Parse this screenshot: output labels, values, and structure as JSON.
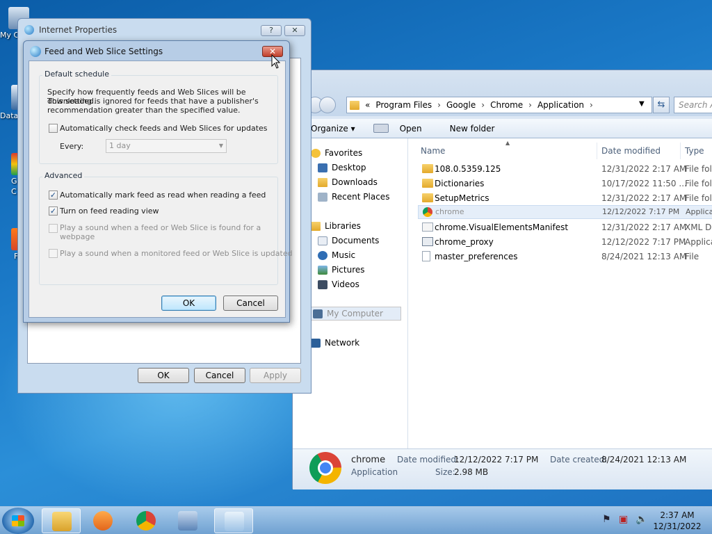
{
  "desktop": {
    "icons": [
      {
        "label": "My C"
      },
      {
        "label": "Data"
      },
      {
        "label": "G"
      },
      {
        "label": "C"
      },
      {
        "label": "F"
      }
    ]
  },
  "explorer": {
    "breadcrumb": [
      "«",
      "Program Files",
      "Google",
      "Chrome",
      "Application"
    ],
    "search_placeholder": "Search Ap",
    "toolbar": {
      "organize": "Organize ▾",
      "open": "Open",
      "new_folder": "New folder"
    },
    "nav": {
      "favorites": "Favorites",
      "desktop": "Desktop",
      "downloads": "Downloads",
      "recent_places": "Recent Places",
      "libraries": "Libraries",
      "documents": "Documents",
      "music": "Music",
      "pictures": "Pictures",
      "videos": "Videos",
      "my_computer": "My Computer",
      "network": "Network"
    },
    "columns": {
      "name": "Name",
      "date_modified": "Date modified",
      "type": "Type"
    },
    "files": [
      {
        "name": "108.0.5359.125",
        "date": "12/31/2022 2:17 AM",
        "type": "File fold",
        "kind": "folder"
      },
      {
        "name": "Dictionaries",
        "date": "10/17/2022 11:50 ...",
        "type": "File fold",
        "kind": "folder"
      },
      {
        "name": "SetupMetrics",
        "date": "12/31/2022 2:17 AM",
        "type": "File fold",
        "kind": "folder"
      },
      {
        "name": "chrome",
        "date": "12/12/2022 7:17 PM",
        "type": "Applica",
        "kind": "chrome"
      },
      {
        "name": "chrome.VisualElementsManifest",
        "date": "12/31/2022 2:17 AM",
        "type": "XML Do",
        "kind": "xml"
      },
      {
        "name": "chrome_proxy",
        "date": "12/12/2022 7:17 PM",
        "type": "Applica",
        "kind": "app"
      },
      {
        "name": "master_preferences",
        "date": "8/24/2021 12:13 AM",
        "type": "File",
        "kind": "file"
      }
    ],
    "details": {
      "name": "chrome",
      "type": "Application",
      "date_modified_label": "Date modified:",
      "date_modified": "12/12/2022 7:17 PM",
      "date_created_label": "Date created:",
      "date_created": "8/24/2021 12:13 AM",
      "size_label": "Size:",
      "size": "2.98 MB"
    }
  },
  "internet_properties": {
    "title": "Internet Properties",
    "help": "?",
    "close": "✕",
    "ok": "OK",
    "cancel": "Cancel",
    "apply": "Apply"
  },
  "feed_dialog": {
    "title": "Feed and Web Slice Settings",
    "close": "✕",
    "default_schedule": "Default schedule",
    "description_1": "Specify how frequently feeds and Web Slices will be downloaded.",
    "description_2": "This setting is ignored for feeds that have a publisher's",
    "description_3": "recommendation greater than the specified value.",
    "auto_check_label": "Automatically check feeds and Web Slices for updates",
    "auto_check": false,
    "every_label": "Every:",
    "every_value": "1 day",
    "advanced": "Advanced",
    "mark_read_label": "Automatically mark feed as read when reading a feed",
    "mark_read": true,
    "reading_view_label": "Turn on feed reading view",
    "reading_view": true,
    "sound_found_label_1": "Play a sound when a feed or Web Slice is found for a",
    "sound_found_label_2": "webpage",
    "sound_updated_label": "Play a sound when a monitored feed or Web Slice is updated",
    "ok": "OK",
    "cancel": "Cancel"
  },
  "taskbar": {
    "time": "2:37 AM",
    "date": "12/31/2022"
  }
}
